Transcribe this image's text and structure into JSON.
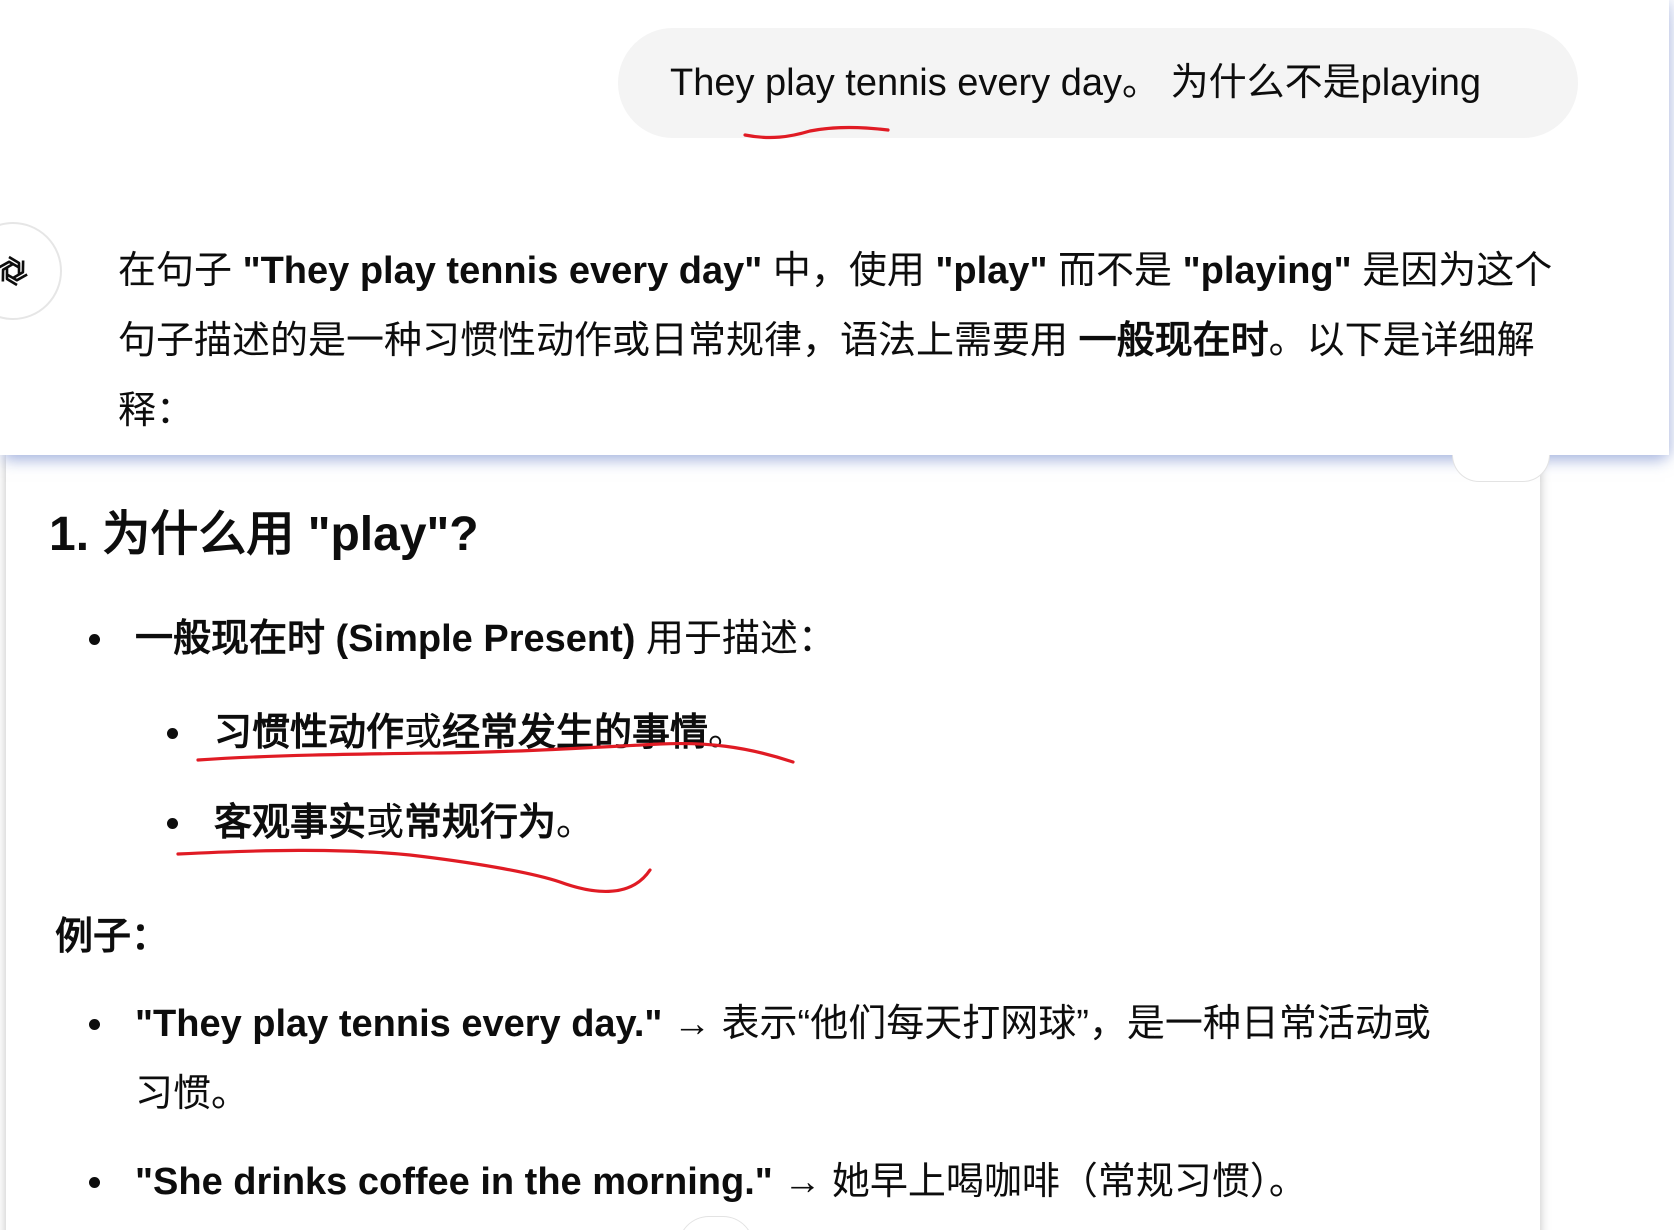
{
  "user_message": {
    "text": "They play tennis every day。 为什么不是playing"
  },
  "assistant": {
    "avatar_icon": "openai-logo-icon",
    "intro": {
      "p1": "在句子 ",
      "b1": "\"They play tennis every day\"",
      "p2": " 中，使用 ",
      "b2": "\"play\"",
      "p3": " 而不是 ",
      "b3": "\"playing\"",
      "p4": " 是因为这个句子描述的是一种习惯性动作或日常规律，语法上需要用 ",
      "b4": "一般现在时",
      "p5": "。以下是详细解释："
    },
    "section1": {
      "heading": "1. 为什么用 \"play\"?",
      "bullet_bold": "一般现在时 (Simple Present)",
      "bullet_rest": " 用于描述：",
      "sub1": {
        "b1": "习惯性动作",
        "t1": "或",
        "b2": "经常发生的事情",
        "t2": "。"
      },
      "sub2": {
        "b1": "客观事实",
        "t1": "或",
        "b2": "常规行为",
        "t2": "。"
      }
    },
    "examples": {
      "label": "例子：",
      "items": [
        {
          "bold": "\"They play tennis every day.\"",
          "rest_line1": " → 表示“他们每天打网球”，是一种日常活动或",
          "rest_line2": "习惯。"
        },
        {
          "bold": "\"She drinks coffee in the morning.\"",
          "rest_line1": " → 她早上喝咖啡（常规习惯）。"
        }
      ]
    }
  },
  "colors": {
    "annotation_red": "#e01b24",
    "bubble_bg": "#f4f4f4",
    "text": "#0d0d0d",
    "panel_shadow": "#8296d2"
  }
}
